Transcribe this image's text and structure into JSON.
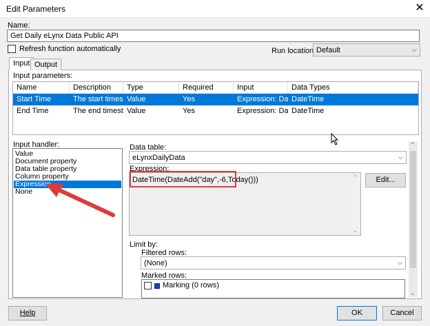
{
  "window": {
    "title": "Edit Parameters"
  },
  "name": {
    "label": "Name:",
    "value": "Get Daily eLynx Data Public API"
  },
  "refresh": {
    "label": "Refresh function automatically",
    "checked": false
  },
  "run_location": {
    "label": "Run location:",
    "value": "Default"
  },
  "tabs": [
    {
      "label": "Input",
      "active": true
    },
    {
      "label": "Output",
      "active": false
    }
  ],
  "input_parameters": {
    "label": "Input parameters:",
    "columns": [
      "Name",
      "Description",
      "Type",
      "Required",
      "Input",
      "Data Types"
    ],
    "rows": [
      {
        "name": "Start Time",
        "description": "The start timesta...",
        "type": "Value",
        "required": "Yes",
        "input": "Expression: Date...",
        "data_types": "DateTime",
        "selected": true
      },
      {
        "name": "End Time",
        "description": "The end timestam...",
        "type": "Value",
        "required": "Yes",
        "input": "Expression: Date...",
        "data_types": "DateTime",
        "selected": false
      }
    ]
  },
  "input_handler": {
    "label": "Input handler:",
    "items": [
      {
        "label": "Value",
        "selected": false
      },
      {
        "label": "Document property",
        "selected": false
      },
      {
        "label": "Data table property",
        "selected": false
      },
      {
        "label": "Column property",
        "selected": false
      },
      {
        "label": "Expression",
        "selected": true
      },
      {
        "label": "None",
        "selected": false
      }
    ]
  },
  "data_table": {
    "label": "Data table:",
    "value": "eLynxDailyData"
  },
  "expression": {
    "label": "Expression:",
    "value": "DateTime(DateAdd(\"day\",-6,Today()))",
    "edit_label": "Edit..."
  },
  "limit_by": {
    "label": "Limit by:",
    "filtered_rows": {
      "label": "Filtered rows:",
      "value": "(None)"
    },
    "marked_rows": {
      "label": "Marked rows:",
      "item": "Marking (0 rows)",
      "marking_color": "#1f3fbf"
    }
  },
  "buttons": {
    "help": "Help",
    "ok": "OK",
    "cancel": "Cancel"
  },
  "colors": {
    "selection": "#0078d7",
    "annotation": "#e03a3a"
  }
}
